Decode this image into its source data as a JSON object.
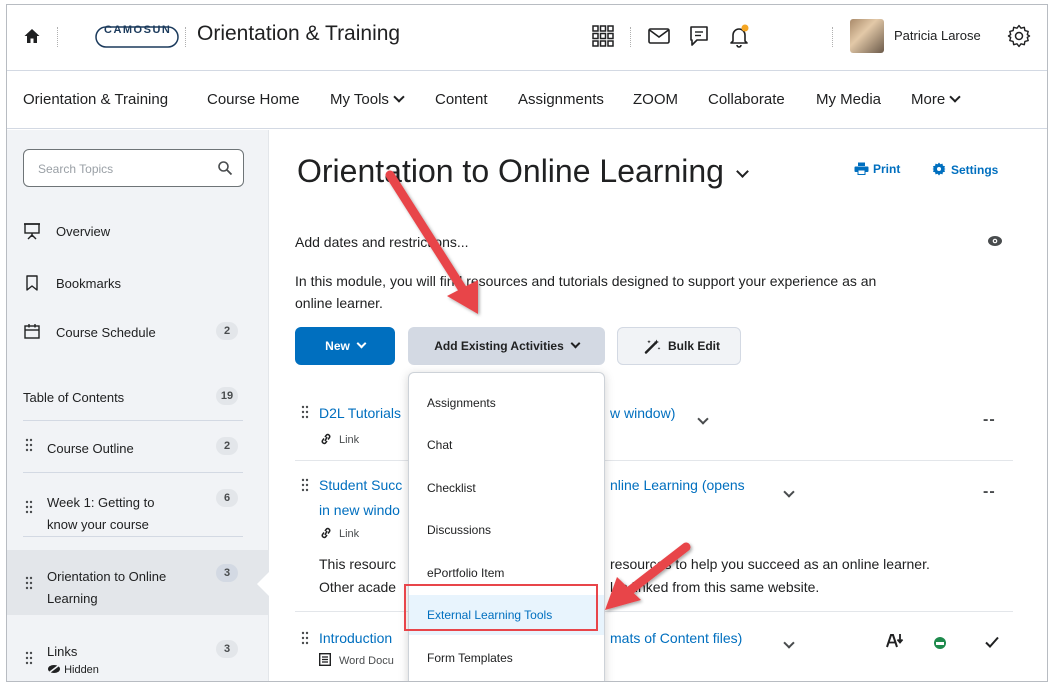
{
  "header": {
    "logo_text": "CAMOSUN",
    "course_title": "Orientation & Training",
    "user_name": "Patricia Larose",
    "icons": [
      "home-icon",
      "apps-grid-icon",
      "mail-icon",
      "chat-bubble-icon",
      "bell-icon",
      "gear-icon"
    ],
    "accent_color": "#006fbf",
    "notification_dot_color": "#f5a623"
  },
  "nav": {
    "items": [
      {
        "label": "Orientation & Training",
        "has_menu": false
      },
      {
        "label": "Course Home",
        "has_menu": false
      },
      {
        "label": "My Tools",
        "has_menu": true
      },
      {
        "label": "Content",
        "has_menu": false
      },
      {
        "label": "Assignments",
        "has_menu": false
      },
      {
        "label": "ZOOM",
        "has_menu": false
      },
      {
        "label": "Collaborate",
        "has_menu": false
      },
      {
        "label": "My Media",
        "has_menu": false
      },
      {
        "label": "More",
        "has_menu": true
      }
    ]
  },
  "sidebar": {
    "search_placeholder": "Search Topics",
    "overview": "Overview",
    "bookmarks": "Bookmarks",
    "schedule": {
      "label": "Course Schedule",
      "count": "2"
    },
    "toc": {
      "label": "Table of Contents",
      "count": "19"
    },
    "modules": [
      {
        "label": "Course Outline",
        "count": "2"
      },
      {
        "label_line1": "Week 1: Getting to",
        "label_line2": "know your course",
        "count": "6"
      },
      {
        "label_line1": "Orientation to Online",
        "label_line2": "Learning",
        "count": "3",
        "selected": true
      },
      {
        "label": "Links",
        "count": "3",
        "status": "Hidden"
      }
    ]
  },
  "main": {
    "title": "Orientation to Online Learning",
    "print": "Print",
    "settings": "Settings",
    "add_dates": "Add dates and restrictions...",
    "description_line1": "In this module, you will find resources and tutorials designed to support your experience as an",
    "description_line2": "online learner.",
    "buttons": {
      "new": "New",
      "add_existing": "Add Existing Activities",
      "bulk_edit": "Bulk Edit"
    },
    "topics": [
      {
        "title_left": "D2L Tutorials",
        "title_right": "w window)",
        "type": "Link",
        "status": "--"
      },
      {
        "title_left_line1": "Student Succ",
        "title_right_line1": "nline Learning (opens",
        "title_left_line2": "in new windo",
        "type": "Link",
        "status": "--",
        "desc_line1_left": "This resourc",
        "desc_line1_right": "resources to help you succeed as an online learner.",
        "desc_line2_left": "Other acade",
        "desc_line2_right": "lso linked from this same website."
      },
      {
        "title_left": "Introduction",
        "title_right": "mats of Content files)",
        "type": "Word Docu"
      }
    ]
  },
  "dropdown": {
    "items": [
      "Assignments",
      "Chat",
      "Checklist",
      "Discussions",
      "ePortfolio Item",
      "External Learning Tools",
      "Form Templates"
    ],
    "highlighted": "External Learning Tools",
    "highlight_color": "#e8454a"
  }
}
